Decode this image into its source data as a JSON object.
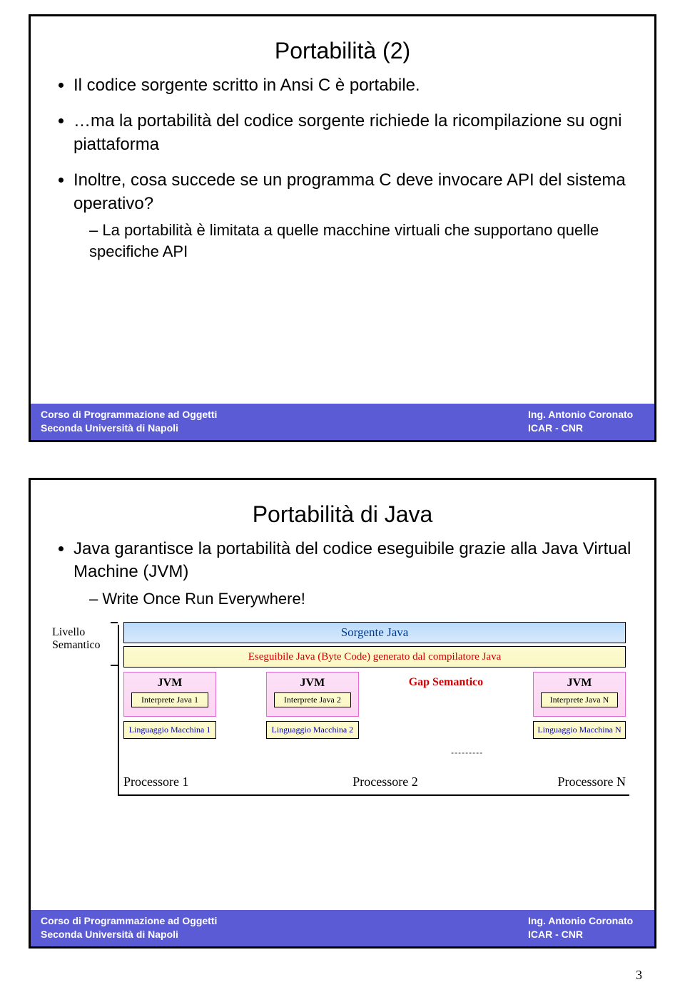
{
  "page_number": "3",
  "footer": {
    "line1_left": "Corso di Programmazione ad Oggetti",
    "line1_right": "Ing. Antonio Coronato",
    "line2_left": "Seconda Università di Napoli",
    "line2_right": "ICAR - CNR"
  },
  "slide1": {
    "title": "Portabilità (2)",
    "b1": "Il codice sorgente scritto in Ansi C è portabile.",
    "b2": "…ma la portabilità del codice sorgente richiede la ricompilazione su ogni piattaforma",
    "b3": "Inoltre, cosa succede se un programma C deve invocare API del sistema operativo?",
    "b3_sub": "La portabilità è limitata a quelle macchine virtuali che supportano quelle specifiche API"
  },
  "slide2": {
    "title": "Portabilità di Java",
    "b1": "Java garantisce la portabilità del codice eseguibile grazie alla Java Virtual Machine (JVM)",
    "b1_sub": "Write Once Run Everywhere!",
    "side_label": "Livello Semantico",
    "row_source": "Sorgente Java",
    "row_exec": "Eseguibile Java (Byte Code) generato dal compilatore Java",
    "jvm_label": "JVM",
    "gap_label": "Gap Semantico",
    "dots": "---------",
    "interp1": "Interprete Java 1",
    "interp2": "Interprete Java 2",
    "interpN": "Interprete Java N",
    "lang1": "Linguaggio Macchina 1",
    "lang2": "Linguaggio Macchina 2",
    "langN": "Linguaggio Macchina N",
    "proc1": "Processore 1",
    "proc2": "Processore 2",
    "procN": "Processore N"
  }
}
